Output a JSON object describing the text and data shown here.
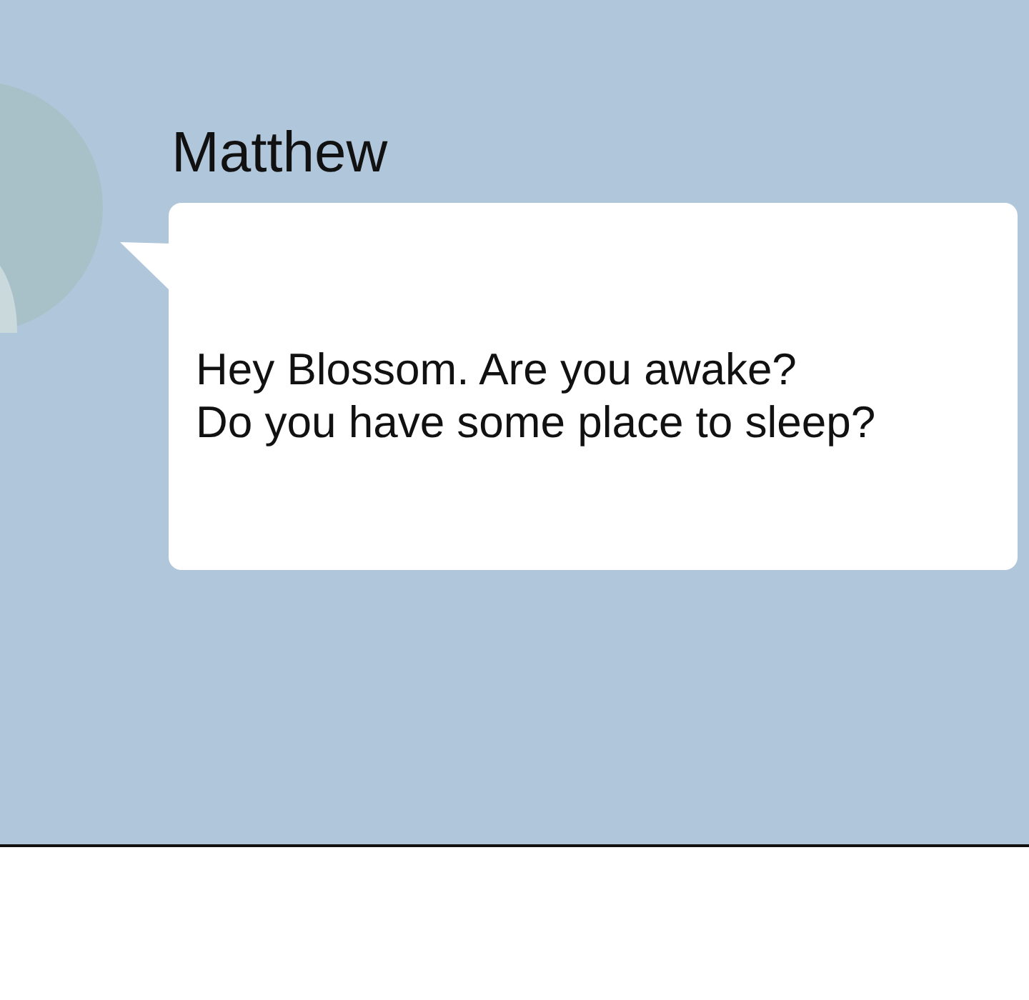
{
  "message": {
    "sender": "Matthew",
    "lines": [
      "Hey Blossom. Are you awake?",
      "Do you have some place to sleep?"
    ]
  }
}
